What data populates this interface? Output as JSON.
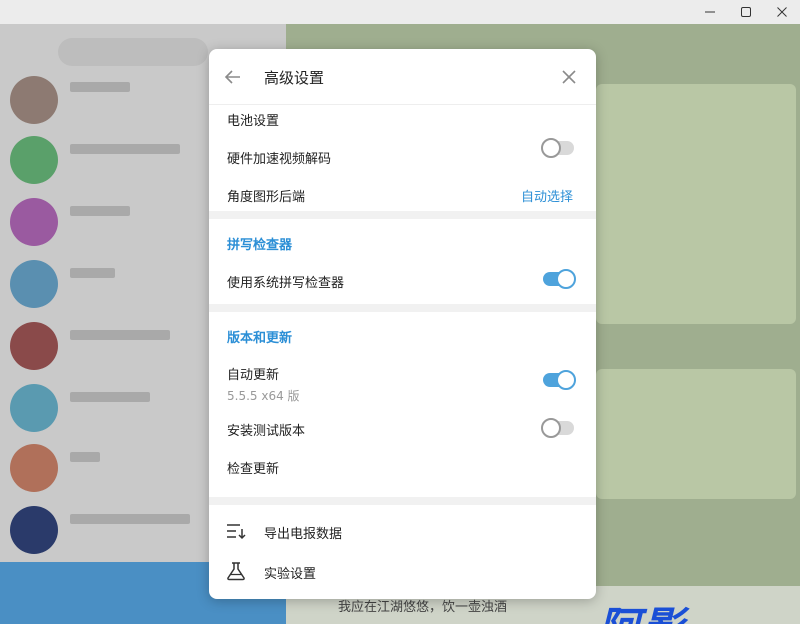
{
  "window": {
    "minimize": "—",
    "maximize": "☐",
    "close": "✕"
  },
  "background": {
    "composer_text": "我应在江湖悠悠，饮一壶浊酒",
    "watermark": "阿影"
  },
  "dialog": {
    "title": "高级设置",
    "rows": {
      "battery": "电池设置",
      "hw_decode": {
        "label": "硬件加速视频解码",
        "on": false
      },
      "angle": {
        "label": "角度图形后端",
        "value": "自动选择"
      }
    },
    "spell": {
      "title": "拼写检查器",
      "system": {
        "label": "使用系统拼写检查器",
        "on": true
      }
    },
    "version": {
      "title": "版本和更新",
      "auto_update": {
        "label": "自动更新",
        "sub": "5.5.5 x64 版",
        "on": true
      },
      "beta": {
        "label": "安装测试版本",
        "on": false
      },
      "check": "检查更新"
    },
    "menu": {
      "export": "导出电报数据",
      "experimental": "实验设置"
    }
  },
  "colors": {
    "accent": "#2c8fd6",
    "toggle_on": "#4ea3dc"
  },
  "icons": {
    "back": "arrow-left-icon",
    "close": "close-icon",
    "export": "export-list-icon",
    "experimental": "flask-icon"
  }
}
